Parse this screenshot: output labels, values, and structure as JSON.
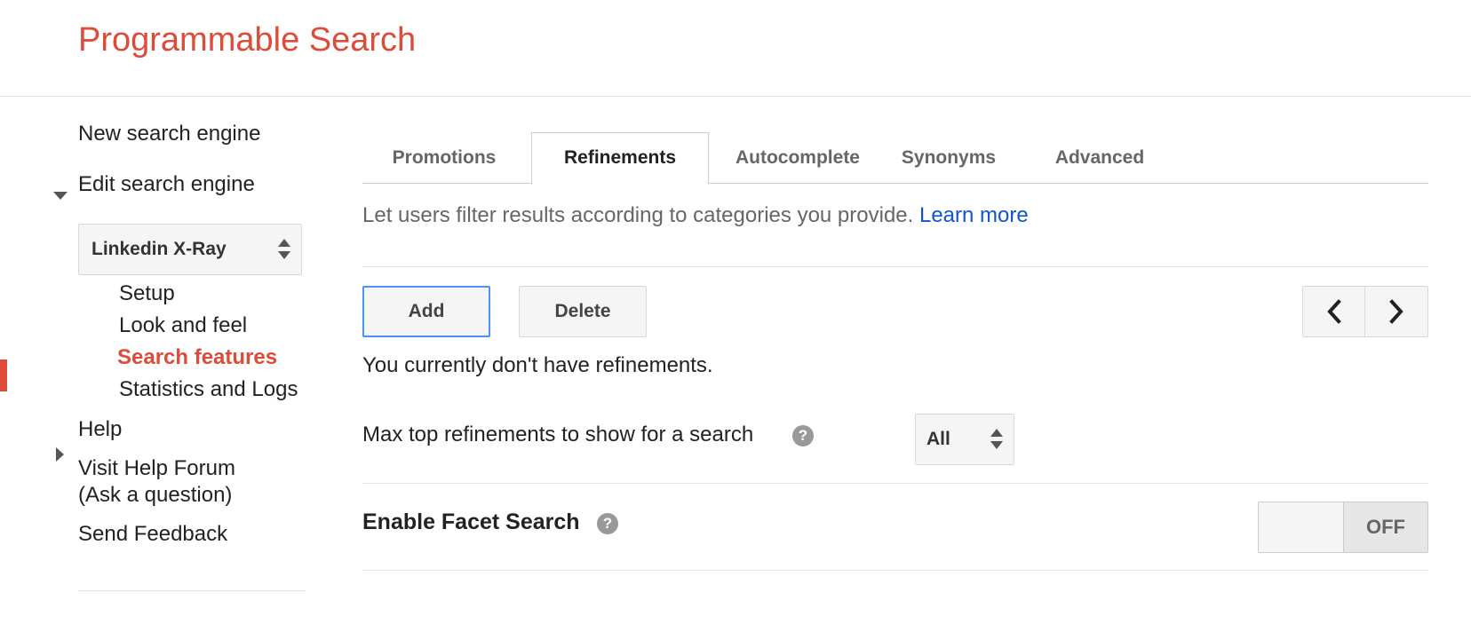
{
  "app": {
    "title": "Programmable Search"
  },
  "sidebar": {
    "new_engine": "New search engine",
    "edit_engine": "Edit search engine",
    "engine_selector": {
      "selected": "Linkedin X-Ray"
    },
    "sub_items": [
      {
        "label": "Setup"
      },
      {
        "label": "Look and feel"
      },
      {
        "label": "Search features",
        "active": true
      },
      {
        "label": "Statistics and Logs"
      }
    ],
    "help": "Help",
    "help_forum_line1": "Visit Help Forum",
    "help_forum_line2": "(Ask a question)",
    "send_feedback": "Send Feedback"
  },
  "tabs": [
    {
      "label": "Promotions"
    },
    {
      "label": "Refinements",
      "active": true
    },
    {
      "label": "Autocomplete"
    },
    {
      "label": "Synonyms"
    },
    {
      "label": "Advanced"
    }
  ],
  "main": {
    "description": "Let users filter results according to categories you provide.",
    "learn_more": "Learn more",
    "add_button": "Add",
    "delete_button": "Delete",
    "empty_message": "You currently don't have refinements.",
    "max_refinements_label": "Max top refinements to show for a search",
    "max_refinements_value": "All",
    "facet_label": "Enable Facet Search",
    "facet_state": "OFF"
  },
  "icons": {
    "help": "?",
    "prev": "chevron-left-icon",
    "next": "chevron-right-icon"
  },
  "colors": {
    "brand": "#dd4b39",
    "link": "#1155cc",
    "focus": "#4d90fe"
  }
}
